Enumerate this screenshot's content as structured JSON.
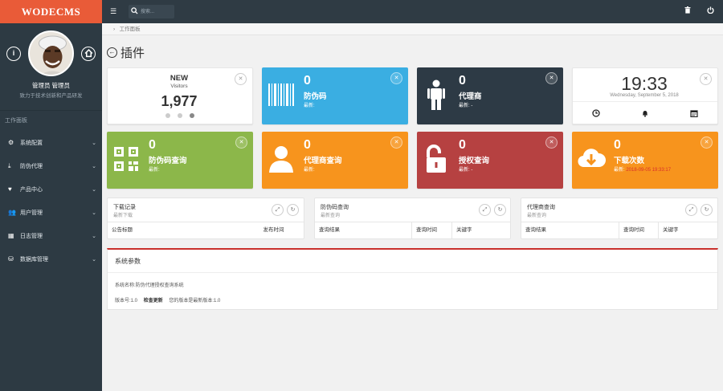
{
  "app": {
    "brand": "WODECMS"
  },
  "topbar": {
    "search_placeholder": "搜索..."
  },
  "profile": {
    "name": "管理员 管理员",
    "subtitle": "致力于技术创新和产品研发"
  },
  "sidebar": {
    "section_title": "工作面板",
    "items": [
      {
        "label": "系统配置",
        "icon": "gears-icon"
      },
      {
        "label": "防伪代理",
        "icon": "download-icon"
      },
      {
        "label": "产品中心",
        "icon": "heart-icon"
      },
      {
        "label": "用户管理",
        "icon": "users-icon"
      },
      {
        "label": "日志管理",
        "icon": "calculator-icon"
      },
      {
        "label": "数据库管理",
        "icon": "database-icon"
      }
    ]
  },
  "breadcrumb": {
    "current": "工作面板"
  },
  "page": {
    "title": "插件"
  },
  "cards": {
    "visitors": {
      "label": "NEW",
      "sub": "Visitors",
      "value": "1,977"
    },
    "anticounterfeit": {
      "value": "0",
      "label": "防伪码",
      "sub": "最新:",
      "color": "#3aaee2"
    },
    "agents": {
      "value": "0",
      "label": "代理商",
      "sub": "最新: -",
      "color": "#2d3a45"
    },
    "clock": {
      "time": "19:33",
      "date": "Wednesday, September 5, 2018"
    },
    "anticounterfeit_query": {
      "value": "0",
      "label": "防伪码查询",
      "sub": "最新:",
      "color": "#8cb74a"
    },
    "agent_query": {
      "value": "0",
      "label": "代理商查询",
      "sub": "最新:",
      "color": "#f7941d"
    },
    "auth_query": {
      "value": "0",
      "label": "授权查询",
      "sub": "最新: -",
      "color": "#b64141"
    },
    "downloads": {
      "value": "0",
      "label": "下载次数",
      "sub_prefix": "最新:",
      "sub_time": "2018-09-05 19:33:17",
      "color": "#f7941d"
    }
  },
  "panels": {
    "downloads": {
      "title": "下载记录",
      "subtitle": "最新下载",
      "columns": [
        "公告标题",
        "发布时间"
      ]
    },
    "anticounterfeit": {
      "title": "防伪码查询",
      "subtitle": "最新查询",
      "columns": [
        "查询结果",
        "查询时间",
        "关键字"
      ]
    },
    "agent": {
      "title": "代理商查询",
      "subtitle": "最新查询",
      "columns": [
        "查询结果",
        "查询时间",
        "关键字"
      ]
    }
  },
  "sysinfo": {
    "title": "系统参数",
    "system_name": "系统名称:防伪代理授权查询系统",
    "version": "版本号:1.0",
    "check_update": "检查更新",
    "latest_version": "您的版本是最新版本:1.0"
  }
}
